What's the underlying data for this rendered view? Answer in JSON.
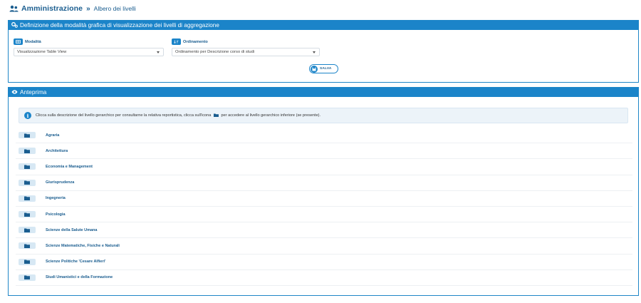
{
  "breadcrumb": {
    "root": "Amministrazione",
    "separator": "»",
    "current": "Albero dei livelli"
  },
  "config_panel": {
    "title": "Definizione della modalità grafica di visualizzazione dei livelli di aggregazione",
    "modalita": {
      "label": "Modalità",
      "value": "Visualizzazione Table View"
    },
    "ordinamento": {
      "label": "Ordinamento",
      "value": "Ordinamento per Descrizione corso di studi"
    },
    "save_label": "SALVA"
  },
  "preview_panel": {
    "title": "Anteprima",
    "info_before": "Clicca sulla descrizione del livello gerarchico per consultarne la relativa reportistica, clicca sull'icona",
    "info_after": "per accedere al livello gerarchico inferiore (se presente).",
    "items": [
      {
        "label": "Agraria"
      },
      {
        "label": "Architettura"
      },
      {
        "label": "Economia e Management"
      },
      {
        "label": "Giurisprudenza"
      },
      {
        "label": "Ingegneria"
      },
      {
        "label": "Psicologia"
      },
      {
        "label": "Scienze della Salute Umana"
      },
      {
        "label": "Scienze Matematiche, Fisiche e Naturali"
      },
      {
        "label": "Scienze Politiche 'Cesare Alfieri'"
      },
      {
        "label": "Studi Umanistici e della Formazione"
      }
    ]
  },
  "icons": {
    "breadcrumb": "users-icon",
    "config_header": "gears-icon",
    "modalita": "table-icon",
    "ordinamento": "sort-icon",
    "save": "floppy-disk-icon",
    "preview_header": "eye-icon",
    "info": "info-icon",
    "row": "folder-icon"
  },
  "colors": {
    "primary": "#1b84c9",
    "text_link": "#1a5d8f",
    "info_bg": "#ecf3f9",
    "folder_btn_bg": "#d7e8f4"
  }
}
